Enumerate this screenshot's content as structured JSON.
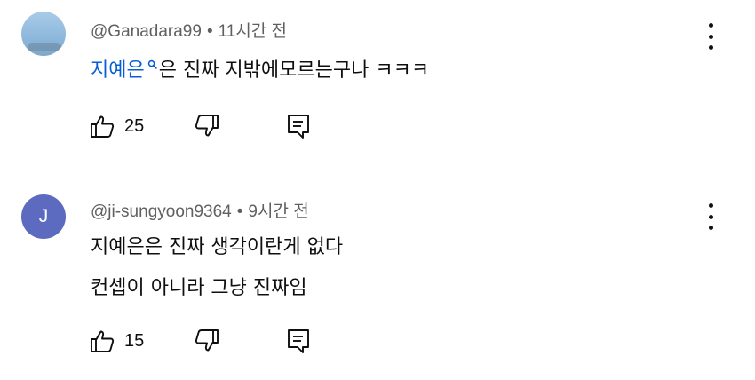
{
  "comments": [
    {
      "username": "@Ganadara99",
      "separator": "•",
      "time": "11시간 전",
      "mention": "지예은",
      "text_after_mention": "은 진짜 지밖에모르는구나 ㅋㅋㅋ",
      "likes": "25",
      "avatar_color": "#9fc3e2"
    },
    {
      "username": "@ji-sungyoon9364",
      "separator": "•",
      "time": "9시간 전",
      "avatar_letter": "J",
      "avatar_color": "#5c6bc0",
      "lines": [
        "지예은은 진짜 생각이란게 없다",
        "컨셉이 아니라 그냥 진짜임"
      ],
      "likes": "15"
    }
  ],
  "icons": {
    "like": "thumbs-up-icon",
    "dislike": "thumbs-down-icon",
    "reply": "reply-icon",
    "more": "more-vertical-icon",
    "search": "search-icon"
  },
  "colors": {
    "link": "#065fd4",
    "meta": "#606060",
    "text": "#0f0f0f"
  }
}
